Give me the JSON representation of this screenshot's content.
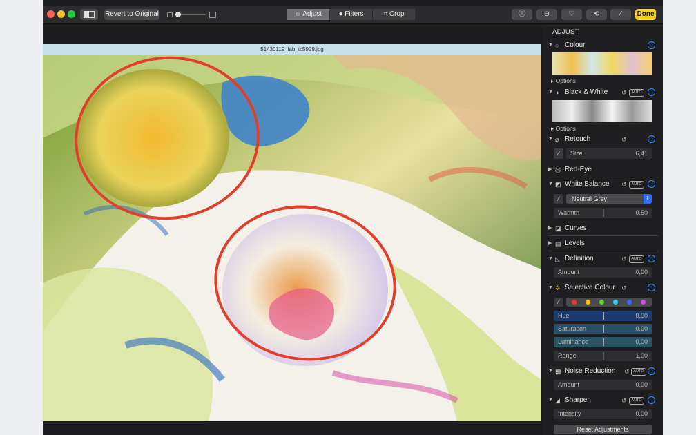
{
  "toolbar": {
    "compare_icon": "split-view-icon",
    "revert_label": "Revert to Original",
    "tabs": [
      {
        "label": "Adjust",
        "icon": "sun-icon",
        "active": true
      },
      {
        "label": "Filters",
        "icon": "filters-icon",
        "active": false
      },
      {
        "label": "Crop",
        "icon": "crop-icon",
        "active": false
      }
    ],
    "right_icons": [
      "info-icon",
      "more-icon",
      "heart-icon",
      "share-icon",
      "magic-wand-icon"
    ],
    "done_label": "Done",
    "accent": "#f7d117"
  },
  "canvas": {
    "filename": "51430119_lab_tc5929.jpg"
  },
  "sidebar": {
    "heading": "ADJUST",
    "accent": "#3b8fff",
    "colour": {
      "label": "Colour",
      "options": "Options"
    },
    "black_white": {
      "label": "Black & White",
      "auto": "AUTO",
      "options": "Options"
    },
    "retouch": {
      "label": "Retouch",
      "size_label": "Size",
      "size_value": "6,41"
    },
    "red_eye": {
      "label": "Red-Eye"
    },
    "white_balance": {
      "label": "White Balance",
      "auto": "AUTO",
      "preset": "Neutral Grey",
      "warmth_label": "Warmth",
      "warmth_value": "0,50"
    },
    "curves": {
      "label": "Curves"
    },
    "levels": {
      "label": "Levels"
    },
    "definition": {
      "label": "Definition",
      "auto": "AUTO",
      "amount_label": "Amount",
      "amount_value": "0,00"
    },
    "selective_colour": {
      "label": "Selective Colour",
      "swatches": [
        "#e53935",
        "#f5c400",
        "#6ccf3a",
        "#3fd0f0",
        "#2d6cff",
        "#d04be0"
      ],
      "hue_label": "Hue",
      "hue_value": "0,00",
      "saturation_label": "Saturation",
      "saturation_value": "0,00",
      "luminance_label": "Luminance",
      "luminance_value": "0,00",
      "range_label": "Range",
      "range_value": "1,00"
    },
    "noise_reduction": {
      "label": "Noise Reduction",
      "auto": "AUTO",
      "amount_label": "Amount",
      "amount_value": "0,00"
    },
    "sharpen": {
      "label": "Sharpen",
      "auto": "AUTO",
      "intensity_label": "Intensity",
      "intensity_value": "0,00"
    },
    "reset_label": "Reset Adjustments"
  }
}
